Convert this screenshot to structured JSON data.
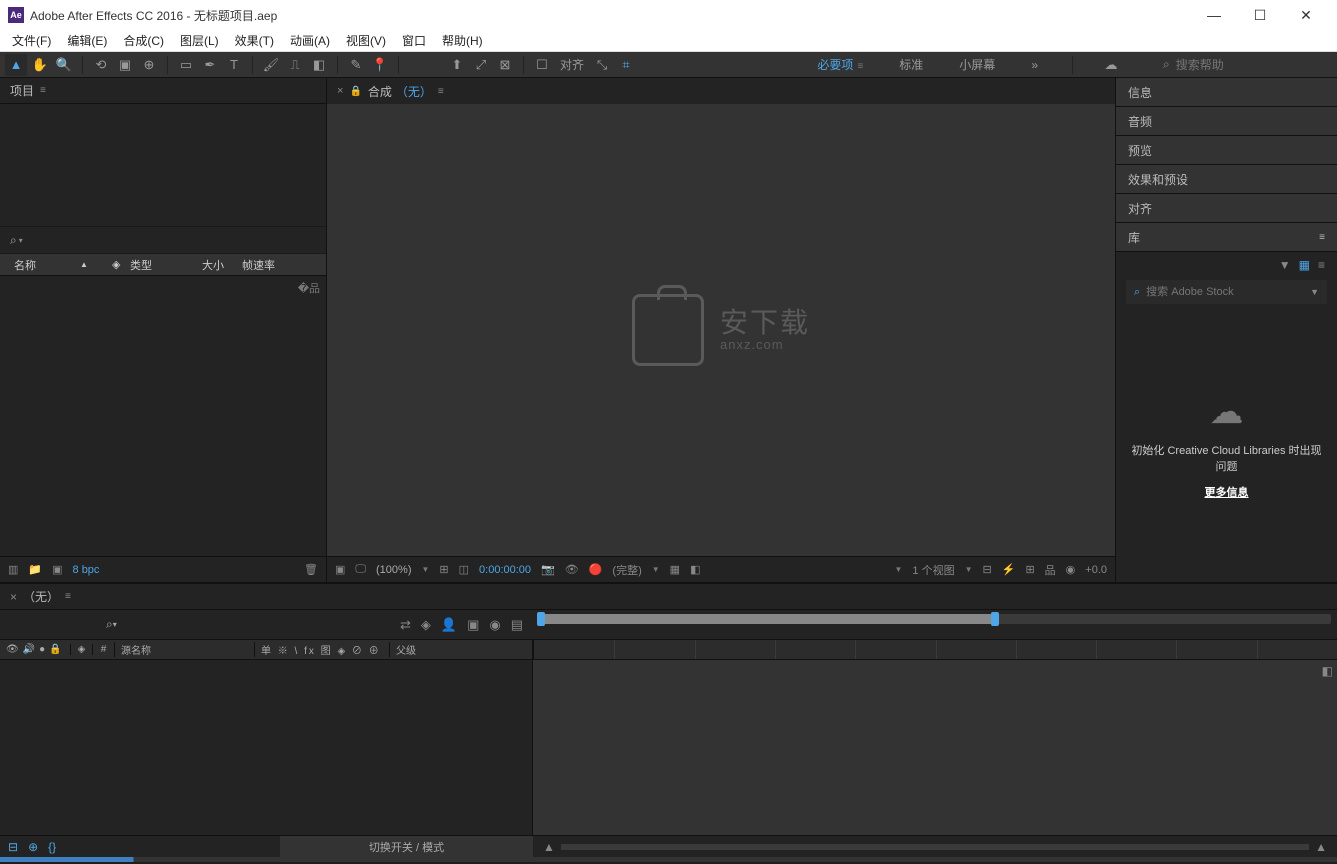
{
  "titlebar": {
    "app": "Adobe After Effects CC 2016",
    "project": "无标题项目.aep",
    "logo": "Ae"
  },
  "menubar": [
    "文件(F)",
    "编辑(E)",
    "合成(C)",
    "图层(L)",
    "效果(T)",
    "动画(A)",
    "视图(V)",
    "窗口",
    "帮助(H)"
  ],
  "toolbar": {
    "align_label": "对齐",
    "workspaces": {
      "active": "必要项",
      "items": [
        "标准",
        "小屏幕"
      ],
      "more": "»"
    },
    "search_placeholder": "搜索帮助"
  },
  "project": {
    "tab": "项目",
    "columns": {
      "name": "名称",
      "type": "类型",
      "size": "大小",
      "fps": "帧速率"
    },
    "footer": {
      "bpc": "8 bpc"
    }
  },
  "composition": {
    "tab_label": "合成",
    "tab_none": "（无）",
    "watermark_main": "安下载",
    "watermark_sub": "anxz.com",
    "footer": {
      "zoom": "(100%)",
      "timecode": "0:00:00:00",
      "res": "(完整)",
      "views": "1 个视图",
      "exposure": "+0.0"
    }
  },
  "side": {
    "panels": [
      "信息",
      "音频",
      "预览",
      "效果和预设",
      "对齐"
    ],
    "library": {
      "tab": "库",
      "search_placeholder": "搜索 Adobe Stock",
      "error_msg": "初始化 Creative Cloud Libraries 时出现问题",
      "more_info": "更多信息"
    }
  },
  "timeline": {
    "tab_none": "（无）",
    "columns": {
      "src": "源名称",
      "switches": "单 ※ \\ fx 图 ◈ ⊘ ⊕",
      "parent": "父级"
    },
    "footer_mode": "切换开关 / 模式"
  }
}
